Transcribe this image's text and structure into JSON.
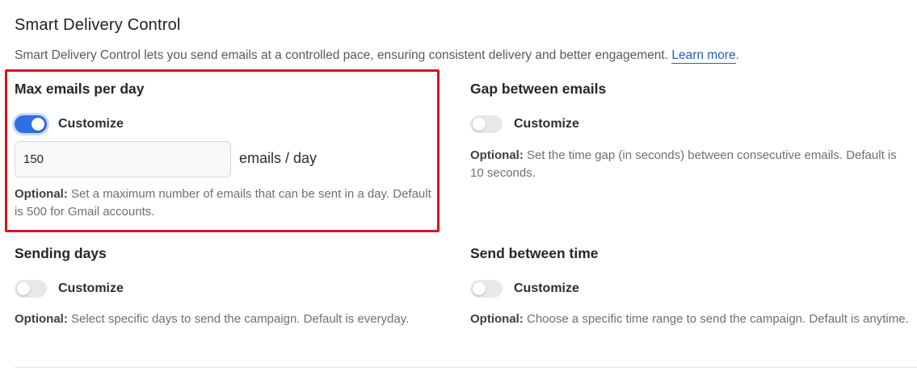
{
  "header": {
    "title": "Smart Delivery Control",
    "description": "Smart Delivery Control lets you send emails at a controlled pace, ensuring consistent delivery and better engagement. ",
    "learn_more": "Learn more",
    "period": "."
  },
  "sections": {
    "max_emails": {
      "title": "Max emails per day",
      "toggle_label": "Customize",
      "toggle_on": true,
      "input_value": "150",
      "unit": "emails / day",
      "note_prefix": "Optional:",
      "note_text": " Set a maximum number of emails that can be sent in a day. Default is 500 for Gmail accounts."
    },
    "gap": {
      "title": "Gap between emails",
      "toggle_label": "Customize",
      "toggle_on": false,
      "note_prefix": "Optional:",
      "note_text": " Set the time gap (in seconds) between consecutive emails. Default is 10 seconds."
    },
    "sending_days": {
      "title": "Sending days",
      "toggle_label": "Customize",
      "toggle_on": false,
      "note_prefix": "Optional:",
      "note_text": " Select specific days to send the campaign. Default is everyday."
    },
    "send_between": {
      "title": "Send between time",
      "toggle_label": "Customize",
      "toggle_on": false,
      "note_prefix": "Optional:",
      "note_text": " Choose a specific time range to send the campaign. Default is anytime."
    }
  },
  "colors": {
    "accent": "#2f6fe4",
    "highlight_border": "#d6141c",
    "link": "#1f5fb8"
  }
}
